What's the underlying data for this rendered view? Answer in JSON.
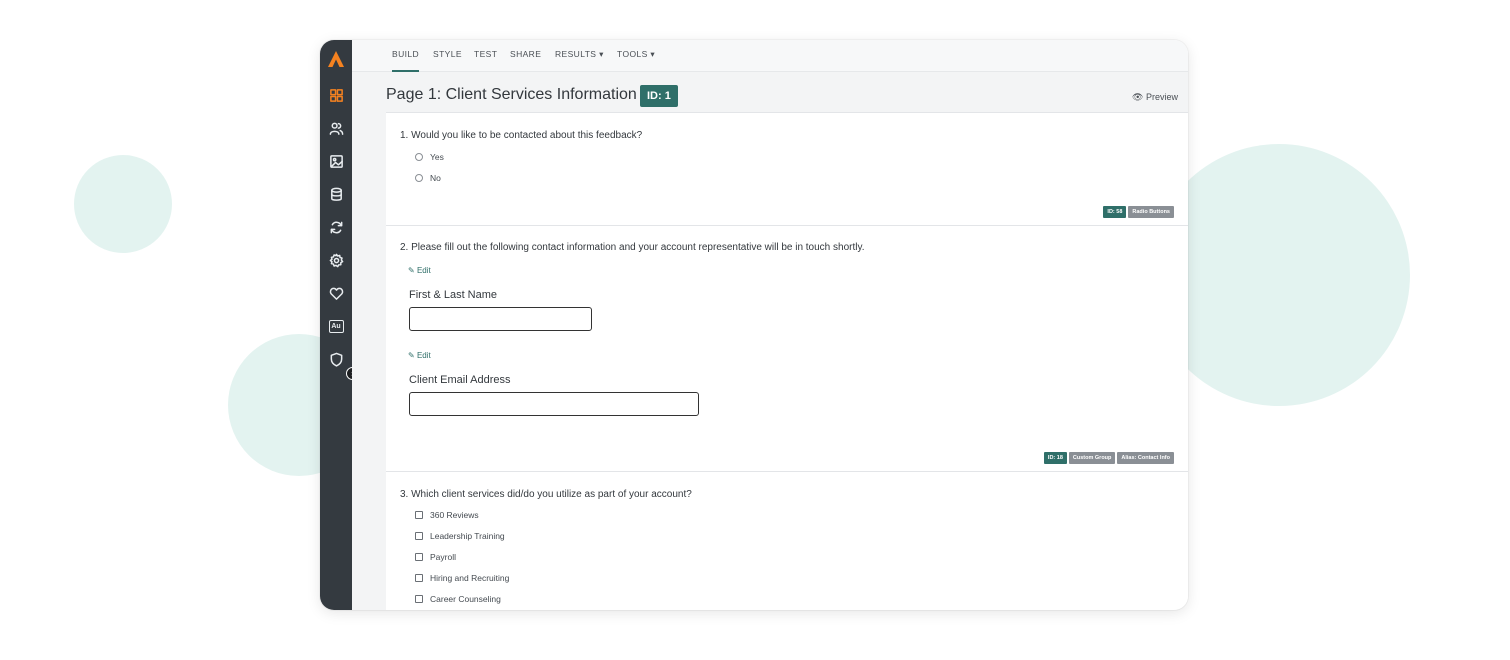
{
  "nav": {
    "tabs": [
      {
        "label": "BUILD",
        "active": true
      },
      {
        "label": "STYLE"
      },
      {
        "label": "TEST"
      },
      {
        "label": "SHARE"
      },
      {
        "label": "RESULTS ▾"
      },
      {
        "label": "TOOLS ▾"
      }
    ]
  },
  "sidebar": {
    "icons": [
      "dashboard-icon",
      "users-icon",
      "image-icon",
      "database-icon",
      "sync-icon",
      "gear-icon",
      "heart-icon",
      "au-icon",
      "shield-icon"
    ],
    "au_label": "Au",
    "accent": "#f58220",
    "background": "#343a40"
  },
  "page": {
    "title": "Page 1: Client Services Information",
    "id_badge": "ID: 1",
    "preview_label": "Preview"
  },
  "questions": [
    {
      "title": "1. Would you like to be contacted about this feedback?",
      "options": [
        "Yes",
        "No"
      ],
      "tags": {
        "id": "ID: 58",
        "type": "Radio Buttons"
      }
    },
    {
      "title": "2. Please fill out the following contact information and your account representative will be in touch shortly.",
      "edit_label": "Edit",
      "fields": [
        {
          "label": "First & Last Name",
          "value": ""
        },
        {
          "label": "Client Email Address",
          "value": ""
        }
      ],
      "tags": {
        "id": "ID: 18",
        "type": "Custom Group",
        "extra": "Alias: Contact Info"
      }
    },
    {
      "title": "3. Which client services did/do you utilize as part of your account?",
      "options": [
        "360 Reviews",
        "Leadership Training",
        "Payroll",
        "Hiring and Recruiting",
        "Career Counseling"
      ]
    }
  ],
  "colors": {
    "brand_teal": "#2f6f69",
    "tag_gray": "#8a8f95",
    "blob": "#e3f3f0"
  }
}
